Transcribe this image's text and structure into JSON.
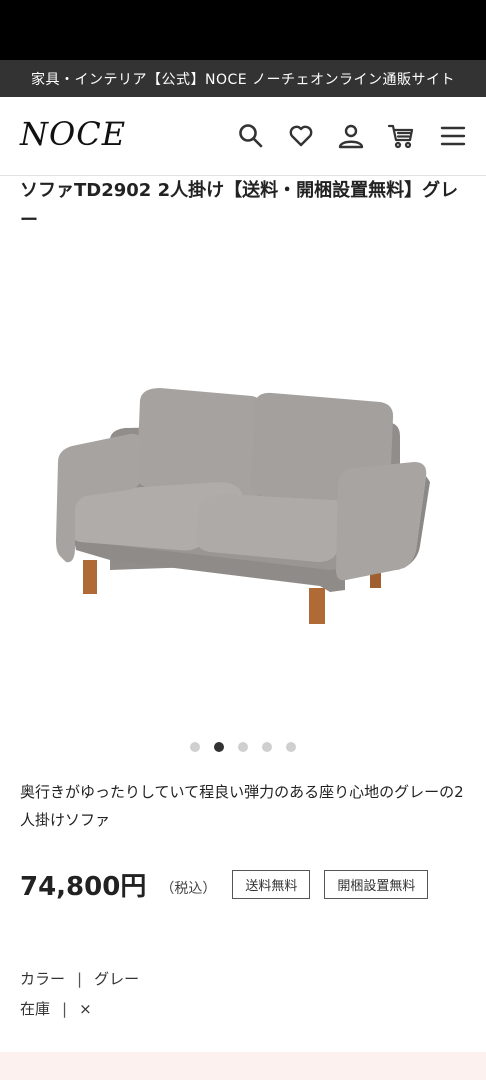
{
  "banner": {
    "text": "家具・インテリア【公式】NOCE ノーチェオンライン通販サイト"
  },
  "header": {
    "logo": "NOCE",
    "icons": [
      "search-icon",
      "heart-icon",
      "user-icon",
      "cart-icon",
      "menu-icon"
    ]
  },
  "product": {
    "title": "ソファTD2902 2人掛け【送料・開梱設置無料】グレー",
    "description": "奥行きがゆったりしていて程良い弾力のある座り心地のグレーの2人掛けソファ",
    "price": "74,800円",
    "tax_note": "（税込）",
    "tags": [
      "送料無料",
      "開梱設置無料"
    ],
    "specs": [
      {
        "label": "カラー",
        "value": "グレー"
      },
      {
        "label": "在庫",
        "value": "×"
      }
    ]
  },
  "carousel": {
    "count": 5,
    "active_index": 1
  },
  "colors": {
    "banner_bg": "#333333",
    "sofa_fabric": "#a09c9a",
    "sofa_legs": "#b06a36",
    "bottom_strip": "#fdf1ef"
  }
}
